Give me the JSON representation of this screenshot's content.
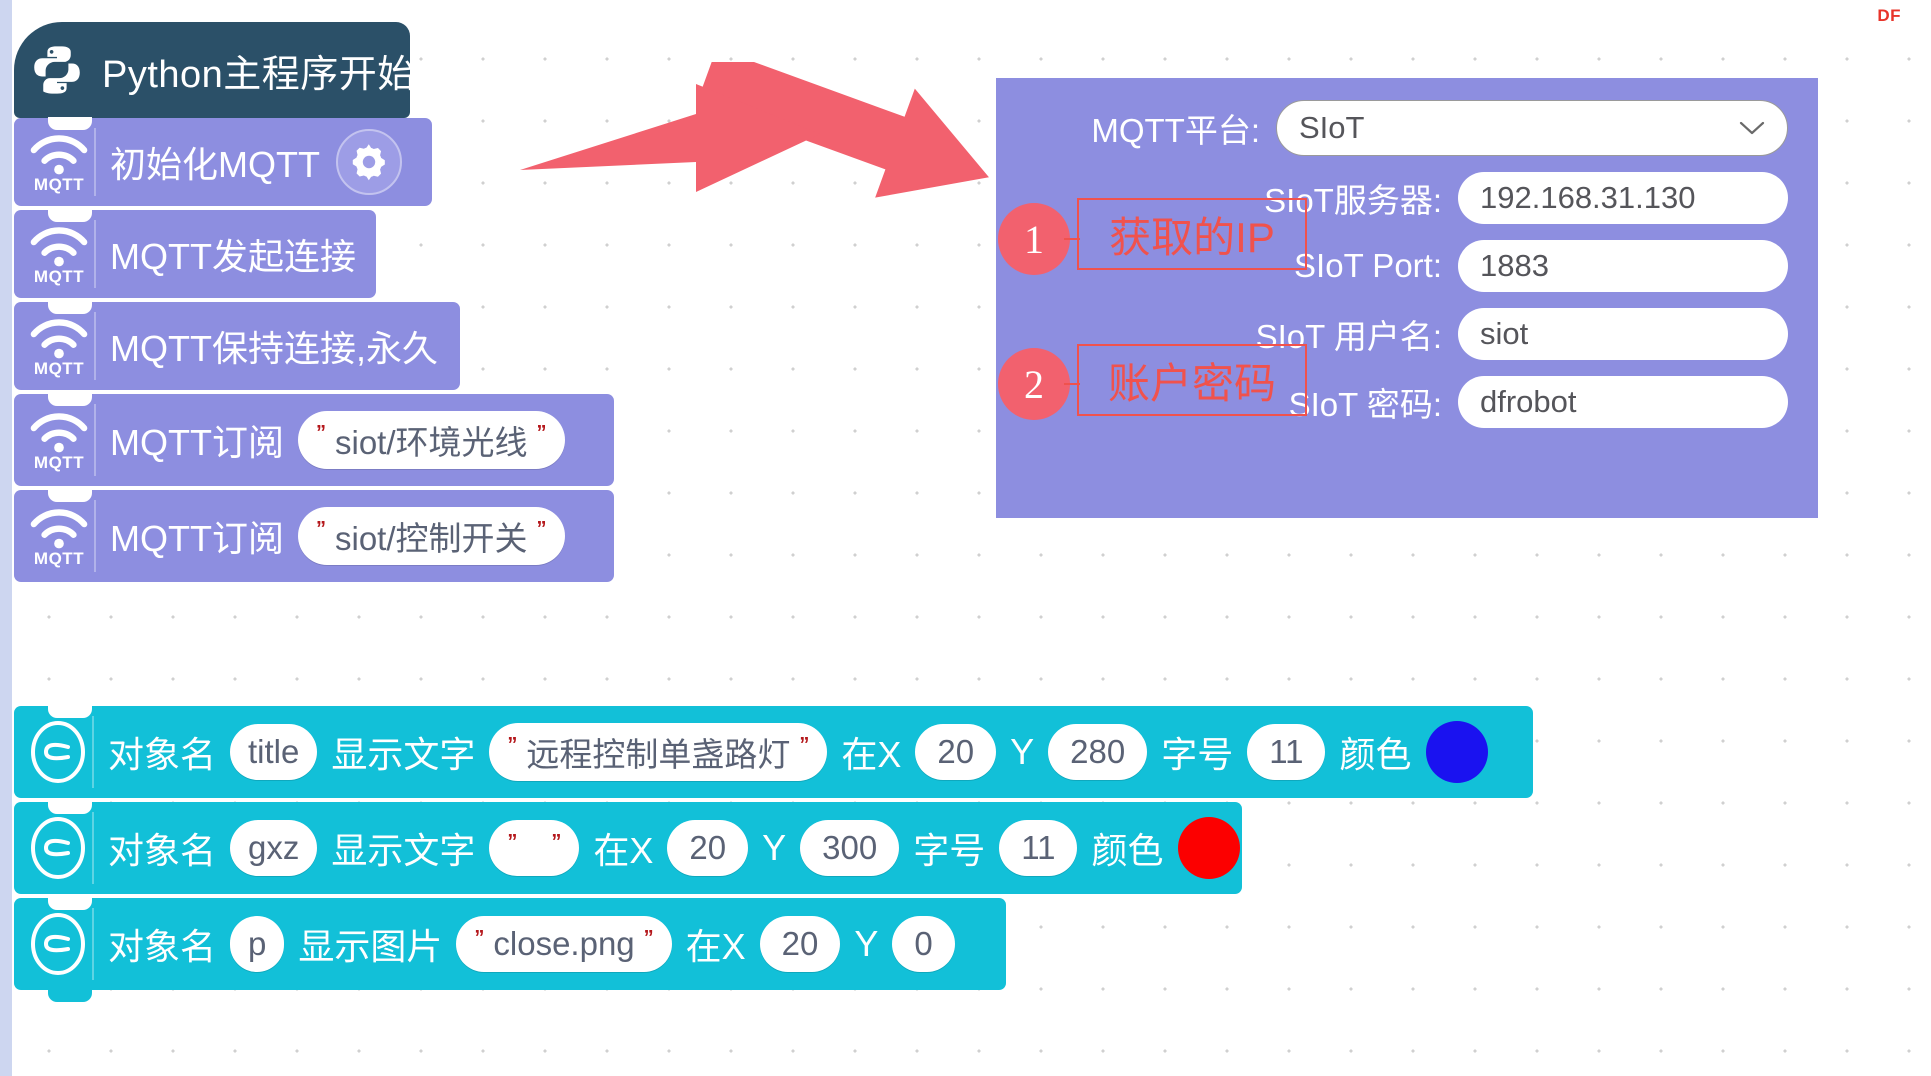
{
  "watermark": "DF",
  "hat_block": {
    "label": "Python主程序开始",
    "icon": "python-logo"
  },
  "mqtt_blocks": [
    {
      "id": "init",
      "label": "初始化MQTT",
      "icon": "mqtt-wifi-icon",
      "icon_word": "MQTT",
      "has_gear": true,
      "gear_icon": "gear-icon"
    },
    {
      "id": "connect",
      "label": "MQTT发起连接",
      "icon": "mqtt-wifi-icon",
      "icon_word": "MQTT",
      "has_gear": false
    },
    {
      "id": "keepalive",
      "label": "MQTT保持连接,永久",
      "icon": "mqtt-wifi-icon",
      "icon_word": "MQTT",
      "has_gear": false
    },
    {
      "id": "subscribe1",
      "label": "MQTT订阅",
      "icon": "mqtt-wifi-icon",
      "icon_word": "MQTT",
      "topic": "siot/环境光线"
    },
    {
      "id": "subscribe2",
      "label": "MQTT订阅",
      "icon": "mqtt-wifi-icon",
      "icon_word": "MQTT",
      "topic": "siot/控制开关"
    }
  ],
  "display_blocks": [
    {
      "id": "title",
      "icon": "object-oval-icon",
      "label_object": "对象名",
      "object_name": "title",
      "label_action": "显示文字",
      "text": "远程控制单盏路灯",
      "label_x": "在X",
      "x": "20",
      "label_y": "Y",
      "y": "280",
      "label_size": "字号",
      "size": "11",
      "label_color": "颜色",
      "color": "#1a12f0"
    },
    {
      "id": "gxz",
      "icon": "object-oval-icon",
      "label_object": "对象名",
      "object_name": "gxz",
      "label_action": "显示文字",
      "text": "",
      "label_x": "在X",
      "x": "20",
      "label_y": "Y",
      "y": "300",
      "label_size": "字号",
      "size": "11",
      "label_color": "颜色",
      "color": "#fc0000"
    },
    {
      "id": "p",
      "icon": "object-oval-icon",
      "label_object": "对象名",
      "object_name": "p",
      "label_action": "显示图片",
      "text": "close.png",
      "label_x": "在X",
      "x": "20",
      "label_y": "Y",
      "y": "0"
    }
  ],
  "settings_panel": {
    "platform_label": "MQTT平台:",
    "platform_value": "SIoT",
    "rows": [
      {
        "label": "SIoT服务器:",
        "value": "192.168.31.130"
      },
      {
        "label": "SIoT Port:",
        "value": "1883"
      },
      {
        "label": "SIoT 用户名:",
        "value": "siot"
      },
      {
        "label": "SIoT 密码:",
        "value": "dfrobot"
      }
    ]
  },
  "annotations": [
    {
      "number": "1",
      "text": "获取的IP"
    },
    {
      "number": "2",
      "text": "账户密码"
    }
  ],
  "colors": {
    "mqtt_block": "#8d8ee0",
    "teal_block": "#12c0d8",
    "hat_block": "#2b5068",
    "annotation_red": "#f0524d",
    "arrow_red": "#f2616e"
  }
}
